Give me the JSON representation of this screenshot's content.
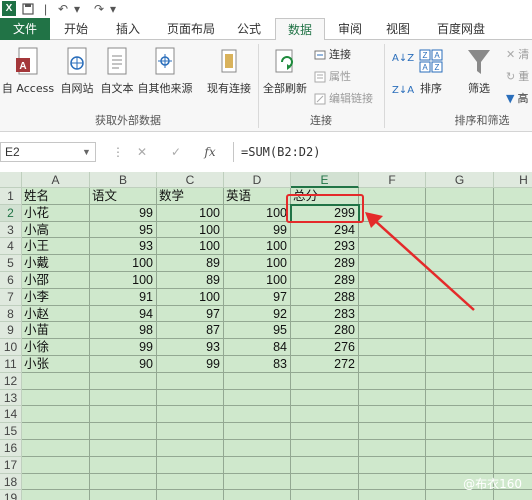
{
  "tabs": [
    "文件",
    "开始",
    "插入",
    "页面布局",
    "公式",
    "数据",
    "审阅",
    "视图",
    "百度网盘"
  ],
  "active_tab": "数据",
  "ribbon": {
    "get_external": {
      "buttons": [
        "自 Access",
        "自网站",
        "自文本",
        "自其他来源",
        "现有连接"
      ],
      "label": "获取外部数据"
    },
    "connections": {
      "refresh_all": "全部刷新",
      "items": [
        "连接",
        "属性",
        "编辑链接"
      ],
      "label": "连接"
    },
    "sort_filter": {
      "sort": "排序",
      "filter": "筛选",
      "items": [
        "清",
        "重",
        "高"
      ],
      "label": "排序和筛选"
    }
  },
  "name_box": "E2",
  "formula": "=SUM(B2:D2)",
  "fx_label": "fx",
  "col_headers": [
    "A",
    "B",
    "C",
    "D",
    "E",
    "F",
    "G",
    "H"
  ],
  "row_headers": [
    "1",
    "2",
    "3",
    "4",
    "5",
    "6",
    "7",
    "8",
    "9",
    "10",
    "11",
    "12",
    "13",
    "14",
    "15",
    "16",
    "17",
    "18",
    "19"
  ],
  "sheet": {
    "header": [
      "姓名",
      "语文",
      "数学",
      "英语",
      "总分"
    ],
    "rows": [
      [
        "小花",
        "99",
        "100",
        "100",
        "299"
      ],
      [
        "小高",
        "95",
        "100",
        "99",
        "294"
      ],
      [
        "小王",
        "93",
        "100",
        "100",
        "293"
      ],
      [
        "小戴",
        "100",
        "89",
        "100",
        "289"
      ],
      [
        "小邵",
        "100",
        "89",
        "100",
        "289"
      ],
      [
        "小李",
        "91",
        "100",
        "97",
        "288"
      ],
      [
        "小赵",
        "94",
        "97",
        "92",
        "283"
      ],
      [
        "小苗",
        "98",
        "87",
        "95",
        "280"
      ],
      [
        "小徐",
        "99",
        "93",
        "84",
        "276"
      ],
      [
        "小张",
        "90",
        "99",
        "83",
        "272"
      ]
    ]
  },
  "selected_cell": "E2",
  "accent_color": "#217346",
  "annotation_color": "#e42a2a",
  "watermark": "@布衣160"
}
